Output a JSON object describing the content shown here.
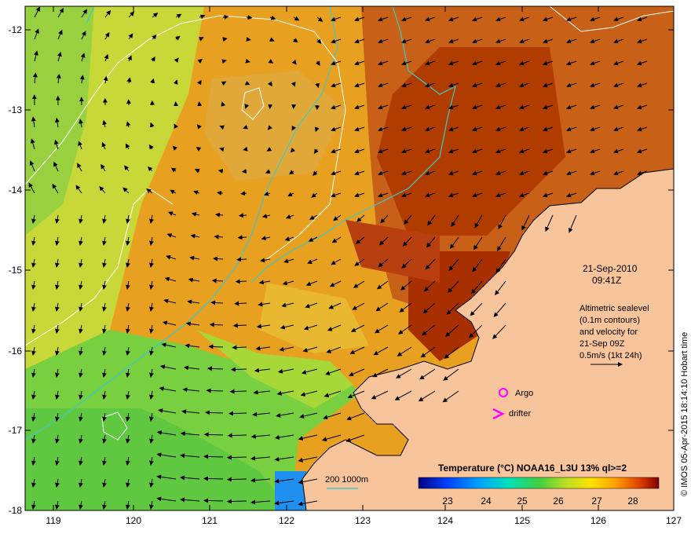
{
  "map": {
    "lon_ticks": [
      "119",
      "120",
      "121",
      "122",
      "123",
      "124",
      "125",
      "126",
      "127"
    ],
    "lat_ticks": [
      "-12",
      "-13",
      "-14",
      "-15",
      "-16",
      "-17",
      "-18"
    ],
    "date_line1": "21-Sep-2010",
    "date_line2": "09:41Z",
    "altimetry_lines": [
      "Altimetric sealevel",
      "(0.1m contours)",
      "and velocity for",
      "21-Sep 09Z",
      "0.5m/s (1kt 24h)"
    ],
    "argo_label": "Argo",
    "drifter_label": "drifter",
    "isobath_label": "200  1000m",
    "colorbar_title": "Temperature (°C) NOAA16_L3U 13% ql>=2",
    "colorbar_ticks": [
      "23",
      "24",
      "25",
      "26",
      "27",
      "28"
    ],
    "credit": "© IMOS 05-Apr-2015 18:14:10 Hobart time",
    "colors": {
      "land": "#f8c49c",
      "isobath": "#40c8c8",
      "argo_marker": "#ff00ff",
      "drifter_marker": "#ff00ff",
      "sst_warm": "#b83000",
      "sst_mid": "#e8a020",
      "sst_cool": "#60d040"
    }
  }
}
